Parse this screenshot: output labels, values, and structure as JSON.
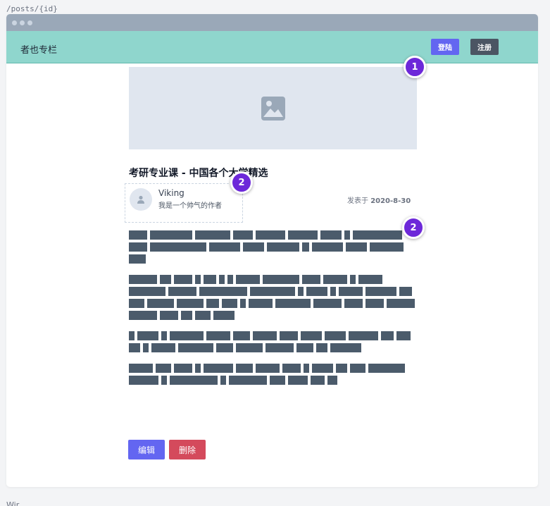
{
  "route": "/posts/{id}",
  "footer_label": "Wir...",
  "navbar": {
    "brand": "者也专栏",
    "login_label": "登陆",
    "register_label": "注册"
  },
  "post": {
    "cover_icon": "image-icon",
    "title": "考研专业课 - 中国各个大学精选",
    "author": {
      "name": "Viking",
      "description": "我是一个帅气的作者",
      "avatar_icon": "user-icon"
    },
    "date_prefix": "发表于",
    "date": "2020-8-30"
  },
  "actions": {
    "edit_label": "编辑",
    "delete_label": "删除"
  },
  "markers": [
    "1",
    "2",
    "2"
  ],
  "colors": {
    "navbar_bg": "#8fd6cd",
    "primary": "#6366f1",
    "dark": "#4b5563",
    "danger": "#d44a5c",
    "marker": "#6d28d9",
    "placeholder": "#e0e6ef"
  }
}
